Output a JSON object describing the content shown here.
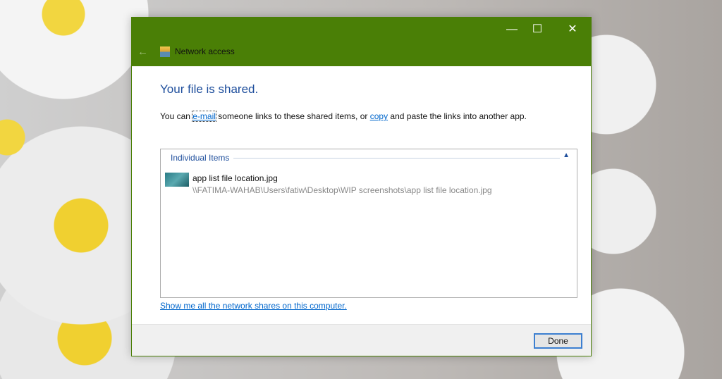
{
  "window": {
    "title": "Network access",
    "minimize": "—",
    "maximize": "☐",
    "close": "✕",
    "back": "←"
  },
  "main": {
    "heading": "Your file is shared.",
    "desc_prefix": "You can ",
    "email_link": "e-mail",
    "desc_middle": " someone links to these shared items, or ",
    "copy_link": "copy",
    "desc_suffix": " and paste the links into another app.",
    "group_label": "Individual Items",
    "collapse_icon": "▲",
    "items": [
      {
        "name": "app list file location.jpg",
        "path": "\\\\FATIMA-WAHAB\\Users\\fatiw\\Desktop\\WIP screenshots\\app list file location.jpg"
      }
    ],
    "show_all_link": "Show me all the network shares on this computer."
  },
  "footer": {
    "done_label": "Done"
  }
}
